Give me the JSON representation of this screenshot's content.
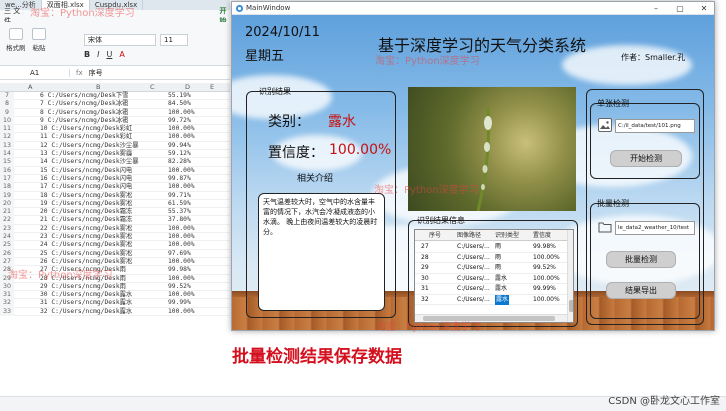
{
  "spreadsheet": {
    "window_tabs": [
      "we...分析",
      "双面相.xlsx",
      "Cuspdu.xlsx"
    ],
    "menu": [
      "三 文件",
      "开始"
    ],
    "ribbon": {
      "paste": "格式刷",
      "paste2": "粘贴",
      "font": "宋体",
      "size": "11",
      "fmt": [
        "B",
        "I",
        "U",
        "A"
      ]
    },
    "cell_ref": "A1",
    "fx": "fx",
    "formula_value": "序号",
    "col_headers": [
      "A",
      "B",
      "C",
      "D",
      "E"
    ],
    "rows": [
      {
        "n": "7",
        "path": "6 C:/Users/ncmg/Desk下雪",
        "conf": "55.19%"
      },
      {
        "n": "8",
        "path": "7 C:/Users/ncmg/Desk冰雹",
        "conf": "84.50%"
      },
      {
        "n": "9",
        "path": "8 C:/Users/ncmg/Desk冰雹",
        "conf": "100.00%"
      },
      {
        "n": "10",
        "path": "9 C:/Users/ncmg/Desk冰雹",
        "conf": "99.72%"
      },
      {
        "n": "11",
        "path": "10 C:/Users/ncmg/Desk彩虹",
        "conf": "100.00%"
      },
      {
        "n": "12",
        "path": "11 C:/Users/ncmg/Desk彩虹",
        "conf": "100.00%"
      },
      {
        "n": "13",
        "path": "12 C:/Users/ncmg/Desk沙尘暴",
        "conf": "99.94%"
      },
      {
        "n": "14",
        "path": "13 C:/Users/ncmg/Desk雾霾",
        "conf": "59.12%"
      },
      {
        "n": "15",
        "path": "14 C:/Users/ncmg/Desk沙尘暴",
        "conf": "82.28%"
      },
      {
        "n": "16",
        "path": "15 C:/Users/ncmg/Desk闪电",
        "conf": "100.00%"
      },
      {
        "n": "17",
        "path": "16 C:/Users/ncmg/Desk闪电",
        "conf": "99.87%"
      },
      {
        "n": "18",
        "path": "17 C:/Users/ncmg/Desk闪电",
        "conf": "100.00%"
      },
      {
        "n": "19",
        "path": "18 C:/Users/ncmg/Desk雾凇",
        "conf": "99.71%"
      },
      {
        "n": "20",
        "path": "19 C:/Users/ncmg/Desk雾凇",
        "conf": "61.59%"
      },
      {
        "n": "21",
        "path": "20 C:/Users/ncmg/Desk霜冻",
        "conf": "55.37%"
      },
      {
        "n": "22",
        "path": "21 C:/Users/ncmg/Desk霜冻",
        "conf": "37.80%"
      },
      {
        "n": "23",
        "path": "22 C:/Users/ncmg/Desk雾凇",
        "conf": "100.00%"
      },
      {
        "n": "24",
        "path": "23 C:/Users/ncmg/Desk雾凇",
        "conf": "100.00%"
      },
      {
        "n": "25",
        "path": "24 C:/Users/ncmg/Desk雾凇",
        "conf": "100.00%"
      },
      {
        "n": "26",
        "path": "25 C:/Users/ncmg/Desk雾凇",
        "conf": "97.69%"
      },
      {
        "n": "27",
        "path": "26 C:/Users/ncmg/Desk雾凇",
        "conf": "100.00%"
      },
      {
        "n": "28",
        "path": "27 C:/Users/ncmg/Desk雨",
        "conf": "99.98%"
      },
      {
        "n": "29",
        "path": "28 C:/Users/ncmg/Desk雨",
        "conf": "100.00%"
      },
      {
        "n": "30",
        "path": "29 C:/Users/ncmg/Desk雨",
        "conf": "99.52%"
      },
      {
        "n": "31",
        "path": "30 C:/Users/ncmg/Desk露水",
        "conf": "100.00%"
      },
      {
        "n": "32",
        "path": "31 C:/Users/ncmg/Desk露水",
        "conf": "99.99%"
      },
      {
        "n": "33",
        "path": "32 C:/Users/ncmg/Desk露水",
        "conf": "100.00%"
      }
    ]
  },
  "window": {
    "title": "MainWindow",
    "date": "2024/10/11",
    "weekday": "星期五",
    "app_title": "基于深度学习的天气分类系统",
    "author": "作者：Smaller.孔",
    "result_group": "识别结果",
    "category_label": "类别：",
    "category_value": "露水",
    "confidence_label": "置信度：",
    "confidence_value": "100.00%",
    "intro_title": "相关介绍",
    "intro_text": "天气温差较大时，空气中的水含量丰富的情况下，水汽会冷凝成液态的小水滴。 晚上由夜间温差较大的凌晨时分。",
    "table_group": "识别结果信息",
    "table_headers": [
      "序号",
      "图像路径",
      "识别类型",
      "置信度"
    ],
    "table_rows": [
      {
        "id": "27",
        "path": "C:/Users/...",
        "type": "雨",
        "conf": "99.98%"
      },
      {
        "id": "28",
        "path": "C:/Users/...",
        "type": "雨",
        "conf": "100.00%"
      },
      {
        "id": "29",
        "path": "C:/Users/...",
        "type": "雨",
        "conf": "99.52%"
      },
      {
        "id": "30",
        "path": "C:/Users/...",
        "type": "露水",
        "conf": "100.00%"
      },
      {
        "id": "31",
        "path": "C:/Users/...",
        "type": "露水",
        "conf": "99.99%"
      },
      {
        "id": "32",
        "path": "C:/Users/...",
        "type": "露水",
        "conf": "100.00%"
      }
    ],
    "single_group": "单张检测",
    "single_path": "C:/il_data/test/101.png",
    "start_button": "开始检测",
    "batch_group": "批量检测",
    "batch_path": "le_data2_weather_10/test",
    "batch_button": "批量检测",
    "export_button": "结果导出"
  },
  "caption": "批量检测结果保存数据",
  "footer": "CSDN @卧龙文心工作室",
  "watermark": "淘宝：Python深度学习",
  "colors": {
    "accent_red": "#c81010",
    "caption_red": "#d4101e",
    "selection": "#0b78d0"
  }
}
